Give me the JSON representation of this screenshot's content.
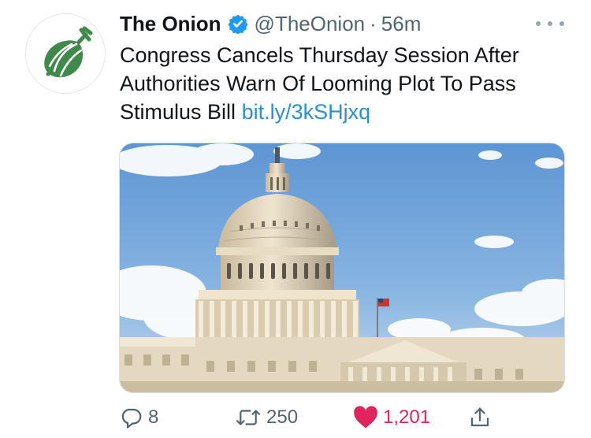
{
  "tweet": {
    "author_name": "The Onion",
    "handle": "@TheOnion",
    "separator": "·",
    "time": "56m",
    "text": "Congress Cancels Thursday Session After Authorities Warn Of Looming Plot To Pass Stimulus Bill",
    "link": "bit.ly/3kSHjxq"
  },
  "actions": {
    "replies": "8",
    "retweets": "250",
    "likes": "1,201"
  },
  "colors": {
    "brand_green": "#3f8a4a",
    "verified_blue": "#1d9bf0",
    "link_blue": "#2a8fd6",
    "like_red": "#e0245e"
  },
  "icons": {
    "avatar": "onion-logo-icon",
    "verified": "verified-badge-icon",
    "more": "more-dots-icon",
    "reply": "reply-icon",
    "retweet": "retweet-icon",
    "like": "heart-icon",
    "share": "share-icon"
  }
}
